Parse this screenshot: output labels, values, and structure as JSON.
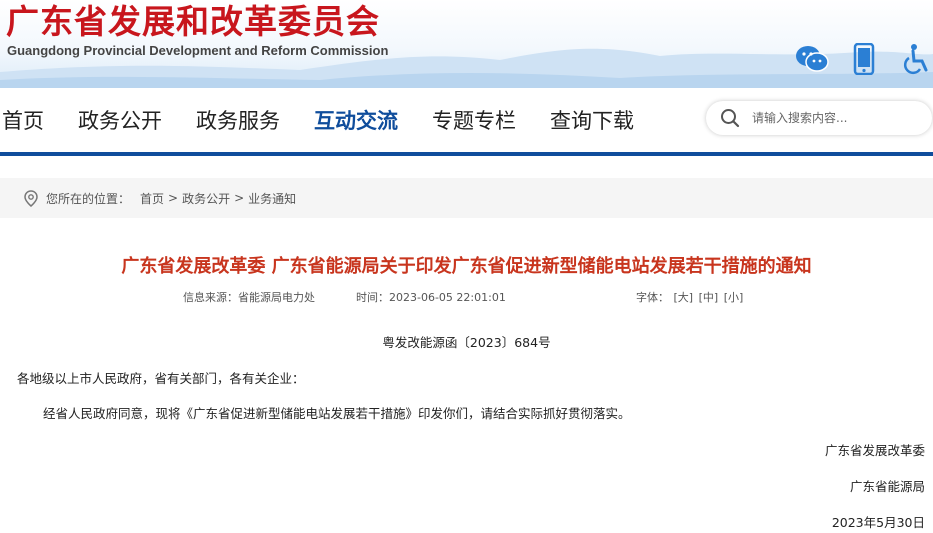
{
  "header": {
    "title": "广东省发展和改革委员会",
    "subtitle": "Guangdong Provincial Development and Reform Commission",
    "tools": [
      "wechat-icon",
      "mobile-icon",
      "accessibility-icon"
    ]
  },
  "nav": {
    "items": [
      {
        "label": "首页"
      },
      {
        "label": "政务公开"
      },
      {
        "label": "政务服务"
      },
      {
        "label": "互动交流"
      },
      {
        "label": "专题专栏"
      },
      {
        "label": "查询下载"
      }
    ],
    "active_index": 3
  },
  "search": {
    "placeholder": "请输入搜索内容..."
  },
  "breadcrumb": {
    "prefix": "您所在的位置：",
    "items": [
      "首页",
      "政务公开",
      "业务通知"
    ],
    "separator": ">"
  },
  "article": {
    "title": "广东省发展改革委 广东省能源局关于印发广东省促进新型储能电站发展若干措施的通知",
    "source": "信息来源：省能源局电力处",
    "time": "时间：2023-06-05 22:01:01",
    "font_label": "字体：",
    "font_options": [
      "[大]",
      "[中]",
      "[小]"
    ],
    "doc_number": "粤发改能源函〔2023〕684号",
    "salutation": "各地级以上市人民政府，省有关部门，各有关企业：",
    "body": "经省人民政府同意，现将《广东省促进新型储能电站发展若干措施》印发你们，请结合实际抓好贯彻落实。",
    "signatures": [
      "广东省发展改革委",
      "广东省能源局"
    ],
    "date": "2023年5月30日"
  },
  "colors": {
    "brand_red": "#c8161d",
    "nav_blue": "#0f4d9c",
    "title_red": "#c8351e"
  }
}
